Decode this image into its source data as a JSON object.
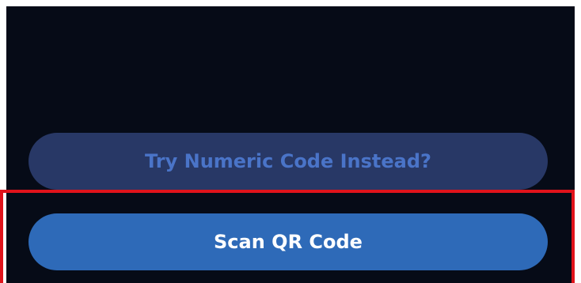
{
  "buttons": {
    "numeric_label": "Try Numeric Code Instead?",
    "scan_label": "Scan QR Code"
  },
  "colors": {
    "background": "#060b17",
    "secondary_button": "#283866",
    "secondary_text": "#4a74c8",
    "primary_button": "#2e6ab8",
    "primary_text": "#ffffff",
    "highlight": "#e0131b"
  }
}
